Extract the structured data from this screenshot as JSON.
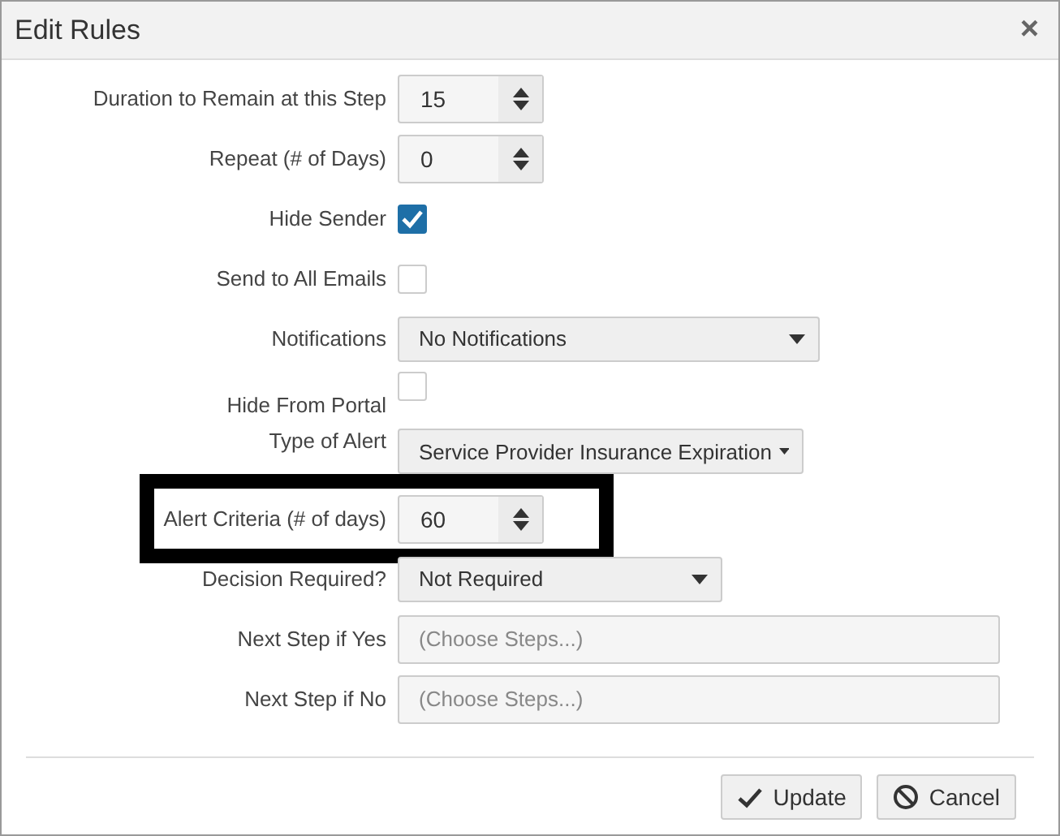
{
  "dialog": {
    "title": "Edit Rules",
    "close": "×"
  },
  "fields": [
    {
      "kind": "number",
      "label": "Duration to Remain at this Step",
      "value": "15",
      "highlighted": false
    },
    {
      "kind": "number",
      "label": "Repeat (# of Days)",
      "value": "0",
      "highlighted": false
    },
    {
      "kind": "checkbox",
      "label": "Hide Sender",
      "checked": true
    },
    {
      "kind": "checkbox",
      "label": "Send to All Emails",
      "checked": false
    },
    {
      "kind": "select",
      "label": "Notifications",
      "value": "No Notifications"
    },
    {
      "kind": "checkbox",
      "label": "Hide From Portal",
      "checked": false
    },
    {
      "kind": "select",
      "label": "Type of Alert",
      "value": "Service Provider Insurance Expiration"
    },
    {
      "kind": "number",
      "label": "Alert Criteria (# of days)",
      "value": "60",
      "highlighted": true
    },
    {
      "kind": "select",
      "label": "Decision Required?",
      "value": "Not Required"
    },
    {
      "kind": "text",
      "label": "Next Step if Yes",
      "placeholder": "(Choose Steps...)"
    },
    {
      "kind": "text",
      "label": "Next Step if No",
      "placeholder": "(Choose Steps...)"
    }
  ],
  "buttons": [
    {
      "kind": "update",
      "label": "Update"
    },
    {
      "kind": "cancel",
      "label": "Cancel"
    }
  ]
}
